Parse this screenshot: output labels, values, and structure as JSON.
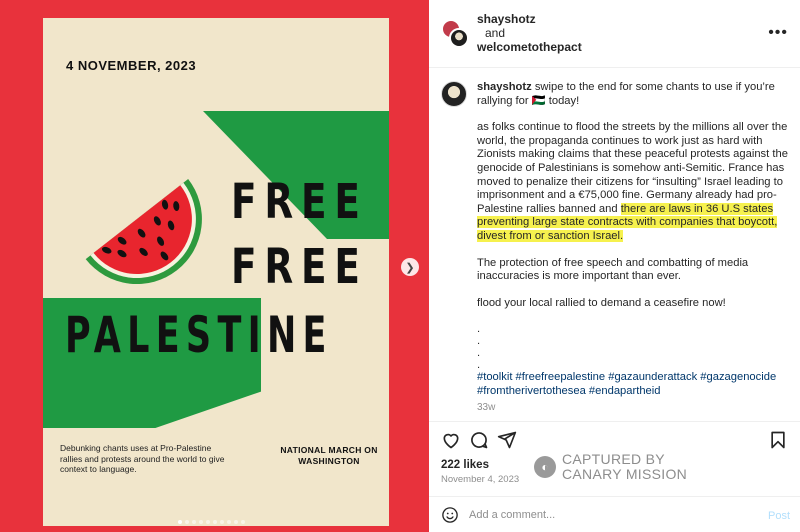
{
  "poster": {
    "date": "4 NOVEMBER, 2023",
    "title_line1": "FREE",
    "title_line2": "FREE",
    "title_line3": "PALESTINE",
    "footer_left": "Debunking chants uses at Pro-Palestine rallies and protests around the world to give context to language.",
    "footer_right": "NATIONAL MARCH ON WASHINGTON",
    "colors": {
      "background": "#e8323c",
      "poster": "#f1e6cb",
      "green": "#1f9a43"
    },
    "carousel_dots": 10,
    "carousel_active": 1
  },
  "header": {
    "user1": "shayshotz",
    "conjunction": "and",
    "user2": "welcometothepact",
    "more_icon": "more-horizontal-icon"
  },
  "caption": {
    "username": "shayshotz",
    "intro": "swipe to the end for some chants to use if you’re rallying for 🇵🇸 today!",
    "p1_before": "as folks continue to flood the streets by the millions all over the world, the propaganda continues to work just as hard with Zionists making claims that these peaceful protests against the genocide of Palestinians is somehow anti-Semitic. France has moved to penalize their citizens for “insulting” Israel leading to imprisonment and a €75,000 fine. Germany already had pro-Palestine rallies banned and ",
    "p1_highlight": "there are laws in 36 U.S states preventing large state contracts with companies that boycott, divest from or sanction Israel.",
    "p2": "The protection of free speech and combatting of media inaccuracies is more important than ever.",
    "p3": "flood your local rallied to demand a ceasefire now!",
    "dot": ".",
    "hashtags_line1": "#toolkit #freefreepalestine #gazaunderattack #gazagenocide",
    "hashtags_line2": "#fromtherivertothesea #endapartheid",
    "time_ago": "33w",
    "highlight_color": "#f6f14e"
  },
  "actions": {
    "likes": "222 likes",
    "date": "November 4, 2023"
  },
  "watermark": {
    "line1": "CAPTURED BY",
    "line2": "CANARY MISSION"
  },
  "comment": {
    "placeholder": "Add a comment...",
    "post_label": "Post"
  }
}
